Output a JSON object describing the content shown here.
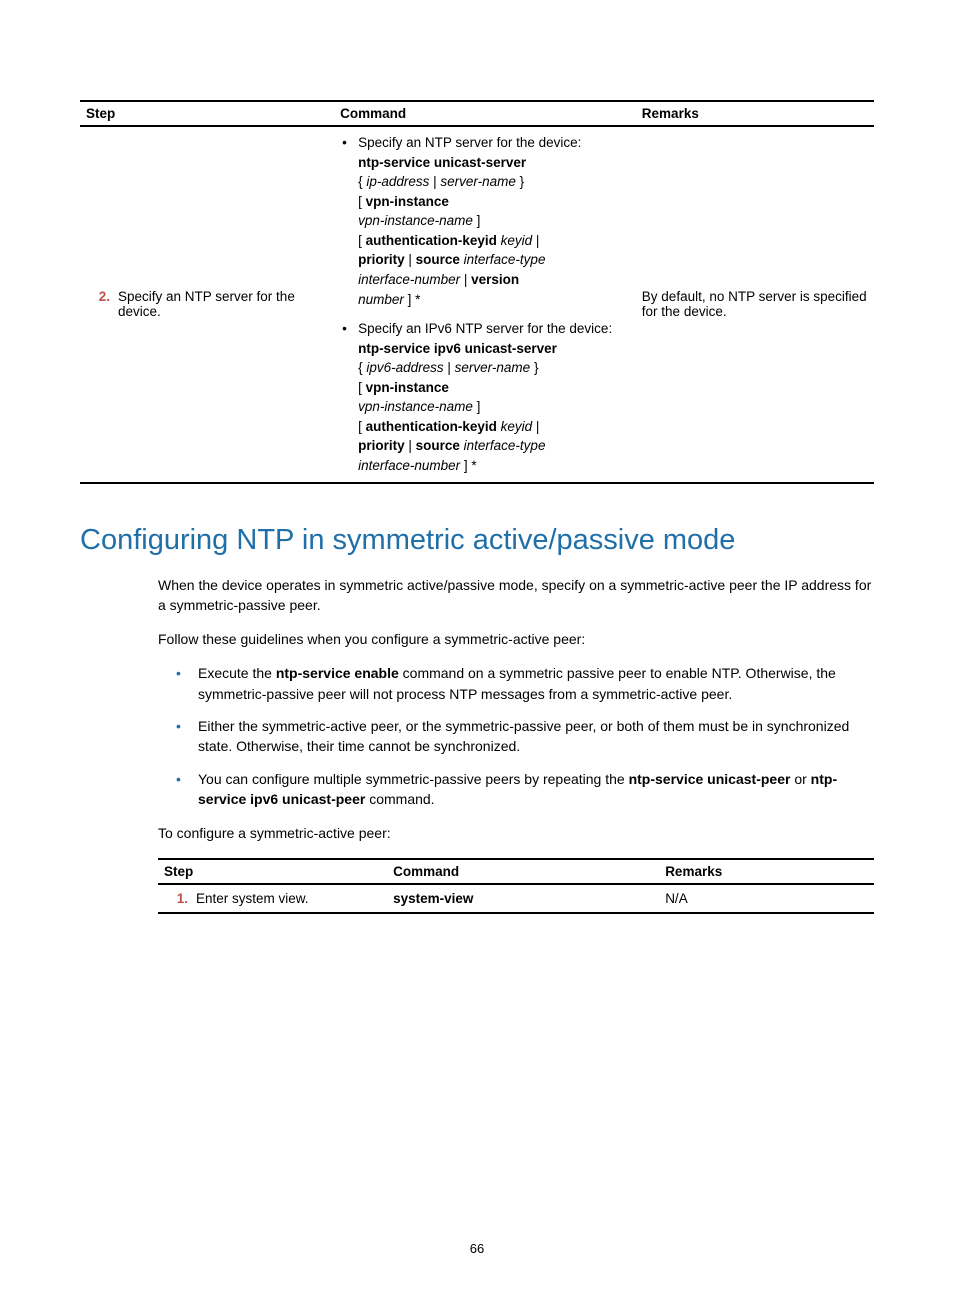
{
  "table1": {
    "headers": {
      "step": "Step",
      "command": "Command",
      "remarks": "Remarks"
    },
    "row": {
      "num": "2.",
      "step_text": "Specify an NTP server for the device.",
      "remarks": "By default, no NTP server is specified for the device.",
      "cmd_a_intro": "Specify an NTP server for the device:",
      "cmd_b_intro": "Specify an IPv6 NTP server for the device:"
    }
  },
  "section_title": "Configuring NTP in symmetric active/passive mode",
  "para1": "When the device operates in symmetric active/passive mode, specify on a symmetric-active peer the IP address for a symmetric-passive peer.",
  "para2": "Follow these guidelines when you configure a symmetric-active peer:",
  "guides": {
    "g1a": "Execute the ",
    "g1b": "ntp-service enable",
    "g1c": " command on a symmetric passive peer to enable NTP. Otherwise, the symmetric-passive peer will not process NTP messages from a symmetric-active peer.",
    "g2": "Either the symmetric-active peer, or the symmetric-passive peer, or both of them must be in synchronized state. Otherwise, their time cannot be synchronized.",
    "g3a": "You can configure multiple symmetric-passive peers by repeating the ",
    "g3b": "ntp-service unicast-peer",
    "g3c": " or ",
    "g3d": "ntp-service ipv6 unicast-peer",
    "g3e": " command."
  },
  "para3": "To configure a symmetric-active peer:",
  "table2": {
    "headers": {
      "step": "Step",
      "command": "Command",
      "remarks": "Remarks"
    },
    "row": {
      "num": "1.",
      "step_text": "Enter system view.",
      "command": "system-view",
      "remarks": "N/A"
    }
  },
  "cmd_parts": {
    "ntp_unicast_server": "ntp-service unicast-server",
    "ntp_ipv6_unicast_server": "ntp-service ipv6 unicast-server",
    "brace_open": "{ ",
    "brace_close": " }",
    "bracket_open": "[ ",
    "bracket_close": " ]",
    "bracket_close_star": " ] *",
    "ip_address": "ip-address",
    "ipv6_address": "ipv6-address",
    "pipe": " | ",
    "server_name": "server-name",
    "vpn_instance": "vpn-instance",
    "vpn_instance_name": "vpn-instance-name",
    "auth_keyid": "authentication-keyid",
    "keyid": "keyid",
    "priority": "priority",
    "source": "source",
    "interface_type": "interface-type",
    "interface_number": "interface-number",
    "version": "version",
    "number": "number"
  },
  "page_number": "66"
}
